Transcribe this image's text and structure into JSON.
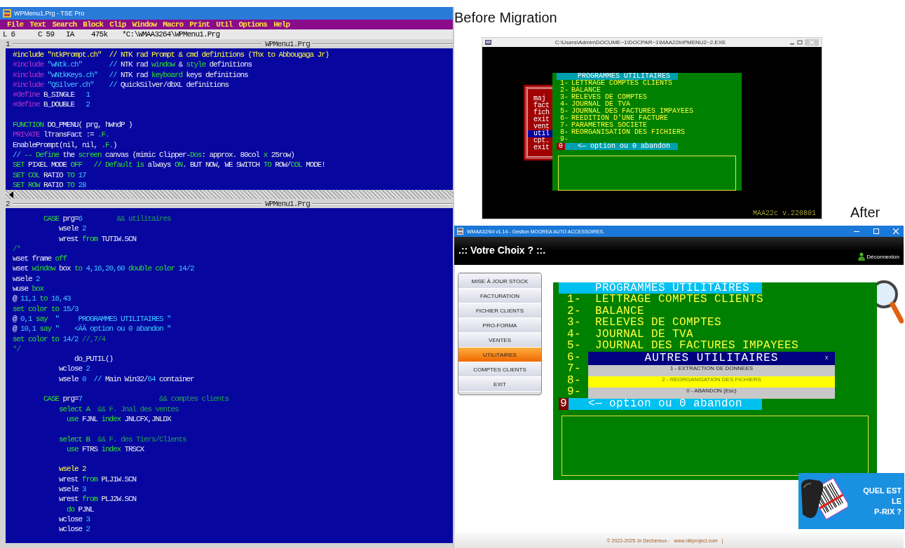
{
  "editor": {
    "title": "WPMenu1.Prg - TSE Pro",
    "menu": [
      "File",
      "Text",
      "Search",
      "Block",
      "Clip",
      "Window",
      "Macro",
      "Print",
      "Util",
      "Options",
      "Help"
    ],
    "status": [
      "L 6",
      "C 59",
      "IA",
      "475k",
      "*C:\\WMAA3264\\WPMenu1.Prg"
    ],
    "panes": [
      {
        "number": "1",
        "filename": "WPMenu1.Prg",
        "scrollbar": true,
        "blocks": [
          {
            "lines": [
              {
                "segments": [
                  {
                    "kind": "current",
                    "text": "#include \"ntkPrompt.ch\"  // NTK rad Prompt & cmd definitions (Thx to Abbougaga Jr)"
                  }
                ]
              },
              {
                "segments": [
                  {
                    "kind": "directive",
                    "text": "#include"
                  },
                  {
                    "kind": "string",
                    "text": " \"wNtk.ch\"       //"
                  },
                  {
                    "kind": "plain",
                    "text": " NTK rad "
                  },
                  {
                    "kind": "keyword",
                    "text": "window"
                  },
                  {
                    "kind": "plain",
                    "text": " & "
                  },
                  {
                    "kind": "keyword",
                    "text": "style"
                  },
                  {
                    "kind": "plain",
                    "text": " definitions"
                  }
                ]
              },
              {
                "segments": [
                  {
                    "kind": "directive",
                    "text": "#include"
                  },
                  {
                    "kind": "string",
                    "text": " \"wNtkKeys.ch\"   //"
                  },
                  {
                    "kind": "plain",
                    "text": " NTK rad "
                  },
                  {
                    "kind": "keyword",
                    "text": "keyboard"
                  },
                  {
                    "kind": "plain",
                    "text": " keys definitions"
                  }
                ]
              },
              {
                "segments": [
                  {
                    "kind": "directive",
                    "text": "#include"
                  },
                  {
                    "kind": "string",
                    "text": " \"QSilver.ch\"    //"
                  },
                  {
                    "kind": "plain",
                    "text": " QuickSilver/dbXL definitions"
                  }
                ]
              },
              {
                "segments": [
                  {
                    "kind": "directive",
                    "text": "#define"
                  },
                  {
                    "kind": "plain",
                    "text": " B_SINGLE   "
                  },
                  {
                    "kind": "number",
                    "text": "1"
                  }
                ]
              },
              {
                "segments": [
                  {
                    "kind": "directive",
                    "text": "#define"
                  },
                  {
                    "kind": "plain",
                    "text": " B_DOUBLE   "
                  },
                  {
                    "kind": "number",
                    "text": "2"
                  }
                ]
              }
            ]
          },
          {
            "lines": [
              {
                "segments": [
                  {
                    "kind": "keyword",
                    "text": "FUNCTION"
                  },
                  {
                    "kind": "plain",
                    "text": " DO_PMENU( prg, hWndP )"
                  }
                ]
              },
              {
                "segments": [
                  {
                    "kind": "directive",
                    "text": "PRIVATE"
                  },
                  {
                    "kind": "plain",
                    "text": " lTransFact := "
                  },
                  {
                    "kind": "keyword",
                    "text": ".F."
                  }
                ]
              },
              {
                "segments": [
                  {
                    "kind": "plain",
                    "text": "EnablePrompt(nil, nil, "
                  },
                  {
                    "kind": "keyword",
                    "text": ".F."
                  },
                  {
                    "kind": "plain",
                    "text": ")"
                  }
                ]
              },
              {
                "segments": [
                  {
                    "kind": "string",
                    "text": "//"
                  },
                  {
                    "kind": "keyword",
                    "text": " -- Define"
                  },
                  {
                    "kind": "plain",
                    "text": " the "
                  },
                  {
                    "kind": "keyword",
                    "text": "screen"
                  },
                  {
                    "kind": "plain",
                    "text": " canvas (mimic Clipper-"
                  },
                  {
                    "kind": "keyword",
                    "text": "Dos"
                  },
                  {
                    "kind": "plain",
                    "text": ": approx. 80col "
                  },
                  {
                    "kind": "keyword",
                    "text": "x"
                  },
                  {
                    "kind": "plain",
                    "text": " 25row)"
                  }
                ]
              },
              {
                "segments": [
                  {
                    "kind": "keyword",
                    "text": "SET"
                  },
                  {
                    "kind": "plain",
                    "text": " PIXEL MODE "
                  },
                  {
                    "kind": "keyword",
                    "text": "OFF   // Default is"
                  },
                  {
                    "kind": "plain",
                    "text": " always "
                  },
                  {
                    "kind": "keyword",
                    "text": "ON"
                  },
                  {
                    "kind": "plain",
                    "text": ". BUT NOW, WE SWITCH "
                  },
                  {
                    "kind": "keyword",
                    "text": "TO"
                  },
                  {
                    "kind": "plain",
                    "text": " ROW/"
                  },
                  {
                    "kind": "keyword",
                    "text": "COL"
                  },
                  {
                    "kind": "plain",
                    "text": " MODE!"
                  }
                ]
              },
              {
                "segments": [
                  {
                    "kind": "keyword",
                    "text": "SET COL"
                  },
                  {
                    "kind": "plain",
                    "text": " RATIO "
                  },
                  {
                    "kind": "keyword",
                    "text": "TO"
                  },
                  {
                    "kind": "number",
                    "text": " 17"
                  }
                ]
              },
              {
                "segments": [
                  {
                    "kind": "keyword",
                    "text": "SET ROW"
                  },
                  {
                    "kind": "plain",
                    "text": " RATIO "
                  },
                  {
                    "kind": "keyword",
                    "text": "TO"
                  },
                  {
                    "kind": "number",
                    "text": " 28"
                  }
                ]
              }
            ]
          }
        ]
      },
      {
        "number": "2",
        "filename": "WPMenu1.Prg",
        "blocks": [
          {
            "lines": [
              {
                "segments": [
                  {
                    "kind": "keyword",
                    "text": "        CASE"
                  },
                  {
                    "kind": "plain",
                    "text": " prg="
                  },
                  {
                    "kind": "number",
                    "text": "6"
                  },
                  {
                    "kind": "comment",
                    "text": "         && utilitaires"
                  }
                ]
              },
              {
                "segments": [
                  {
                    "kind": "plain",
                    "text": "            wsele "
                  },
                  {
                    "kind": "number",
                    "text": "2"
                  }
                ]
              },
              {
                "segments": [
                  {
                    "kind": "plain",
                    "text": "            wrest "
                  },
                  {
                    "kind": "keyword",
                    "text": "from"
                  },
                  {
                    "kind": "plain",
                    "text": " TUTIW.SCN"
                  }
                ]
              },
              {
                "segments": [
                  {
                    "kind": "comment",
                    "text": "/*"
                  }
                ]
              },
              {
                "segments": [
                  {
                    "kind": "plain",
                    "text": "wset frame "
                  },
                  {
                    "kind": "keyword",
                    "text": "off"
                  }
                ]
              },
              {
                "segments": [
                  {
                    "kind": "plain",
                    "text": "wset "
                  },
                  {
                    "kind": "keyword",
                    "text": "window"
                  },
                  {
                    "kind": "plain",
                    "text": " box "
                  },
                  {
                    "kind": "keyword",
                    "text": "to"
                  },
                  {
                    "kind": "number",
                    "text": " 4,16,20,60"
                  },
                  {
                    "kind": "keyword",
                    "text": " double color"
                  },
                  {
                    "kind": "number",
                    "text": " 14/2"
                  }
                ]
              },
              {
                "segments": [
                  {
                    "kind": "plain",
                    "text": "wsele "
                  },
                  {
                    "kind": "number",
                    "text": "2"
                  }
                ]
              },
              {
                "segments": [
                  {
                    "kind": "plain",
                    "text": "wuse "
                  },
                  {
                    "kind": "keyword",
                    "text": "box"
                  }
                ]
              },
              {
                "segments": [
                  {
                    "kind": "plain",
                    "text": "@ "
                  },
                  {
                    "kind": "number",
                    "text": "11,1"
                  },
                  {
                    "kind": "keyword",
                    "text": " to"
                  },
                  {
                    "kind": "number",
                    "text": " 16,43"
                  }
                ]
              },
              {
                "segments": [
                  {
                    "kind": "keyword",
                    "text": "set color to"
                  },
                  {
                    "kind": "number",
                    "text": " 15/3"
                  }
                ]
              },
              {
                "segments": [
                  {
                    "kind": "plain",
                    "text": "@ "
                  },
                  {
                    "kind": "number",
                    "text": "0,1"
                  },
                  {
                    "kind": "keyword",
                    "text": " say"
                  },
                  {
                    "kind": "string",
                    "text": "  \"     PROGRAMMES UTILITAIRES \""
                  }
                ]
              },
              {
                "segments": [
                  {
                    "kind": "plain",
                    "text": "@ "
                  },
                  {
                    "kind": "number",
                    "text": "10,1"
                  },
                  {
                    "kind": "keyword",
                    "text": " say"
                  },
                  {
                    "kind": "string",
                    "text": " \"    <ÄÄ option ou 0 abandon \""
                  }
                ]
              },
              {
                "segments": [
                  {
                    "kind": "keyword",
                    "text": "set color to"
                  },
                  {
                    "kind": "number",
                    "text": " 14/2"
                  },
                  {
                    "kind": "comment",
                    "text": " //,7/4"
                  }
                ]
              },
              {
                "segments": [
                  {
                    "kind": "comment",
                    "text": "*/"
                  }
                ]
              },
              {
                "segments": [
                  {
                    "kind": "plain",
                    "text": "                do_PUTIL()"
                  }
                ]
              },
              {
                "segments": [
                  {
                    "kind": "plain",
                    "text": "            wclose "
                  },
                  {
                    "kind": "number",
                    "text": "2"
                  }
                ]
              },
              {
                "segments": [
                  {
                    "kind": "plain",
                    "text": "            wsele "
                  },
                  {
                    "kind": "number",
                    "text": "0"
                  },
                  {
                    "kind": "string",
                    "text": "  //"
                  },
                  {
                    "kind": "plain",
                    "text": " Main Win32/"
                  },
                  {
                    "kind": "number",
                    "text": "64"
                  },
                  {
                    "kind": "plain",
                    "text": " container"
                  }
                ]
              }
            ]
          },
          {
            "lines": [
              {
                "segments": [
                  {
                    "kind": "keyword",
                    "text": "        CASE"
                  },
                  {
                    "kind": "plain",
                    "text": " prg="
                  },
                  {
                    "kind": "number",
                    "text": "7"
                  },
                  {
                    "kind": "comment",
                    "text": "                    && comptes clients"
                  }
                ]
              },
              {
                "segments": [
                  {
                    "kind": "keyword",
                    "text": "            select A"
                  },
                  {
                    "kind": "comment",
                    "text": "  && F. Jnal des ventes"
                  }
                ]
              },
              {
                "segments": [
                  {
                    "kind": "keyword",
                    "text": "              use"
                  },
                  {
                    "kind": "plain",
                    "text": " FJNL "
                  },
                  {
                    "kind": "keyword",
                    "text": "index"
                  },
                  {
                    "kind": "plain",
                    "text": " JNLCFX,JNLDX"
                  }
                ]
              }
            ]
          },
          {
            "lines": [
              {
                "segments": [
                  {
                    "kind": "keyword",
                    "text": "            select B"
                  },
                  {
                    "kind": "comment",
                    "text": "  && F. des Tiers/Clients"
                  }
                ]
              },
              {
                "segments": [
                  {
                    "kind": "keyword",
                    "text": "              use"
                  },
                  {
                    "kind": "plain",
                    "text": " FTRS "
                  },
                  {
                    "kind": "keyword",
                    "text": "index"
                  },
                  {
                    "kind": "plain",
                    "text": " TRSCX"
                  }
                ]
              }
            ]
          },
          {
            "lines": [
              {
                "segments": [
                  {
                    "kind": "current",
                    "text": "            wsele 2"
                  }
                ]
              },
              {
                "segments": [
                  {
                    "kind": "plain",
                    "text": "            wrest "
                  },
                  {
                    "kind": "keyword",
                    "text": "from"
                  },
                  {
                    "kind": "plain",
                    "text": " PLJ1W.SCN"
                  }
                ]
              },
              {
                "segments": [
                  {
                    "kind": "plain",
                    "text": "            wsele "
                  },
                  {
                    "kind": "number",
                    "text": "3"
                  }
                ]
              },
              {
                "segments": [
                  {
                    "kind": "plain",
                    "text": "            wrest "
                  },
                  {
                    "kind": "keyword",
                    "text": "from"
                  },
                  {
                    "kind": "plain",
                    "text": " PLJ2W.SCN"
                  }
                ]
              },
              {
                "segments": [
                  {
                    "kind": "keyword",
                    "text": "              do"
                  },
                  {
                    "kind": "plain",
                    "text": " PJNL"
                  }
                ]
              },
              {
                "segments": [
                  {
                    "kind": "plain",
                    "text": "            wclose "
                  },
                  {
                    "kind": "number",
                    "text": "3"
                  }
                ]
              },
              {
                "segments": [
                  {
                    "kind": "plain",
                    "text": "            wclose "
                  },
                  {
                    "kind": "number",
                    "text": "2"
                  }
                ]
              }
            ]
          }
        ]
      }
    ]
  },
  "before": {
    "label": "Before Migration",
    "window": {
      "title": "C:\\Users\\Admin\\DOCUME~1\\DOCPAR~1\\MAA22b\\PMENU2~2.EXE",
      "main_menu": [
        {
          "label": "maj",
          "selected": false
        },
        {
          "label": "fact",
          "selected": false
        },
        {
          "label": "fich",
          "selected": false
        },
        {
          "label": "exit",
          "selected": false
        },
        {
          "label": "vent",
          "selected": false
        },
        {
          "label": "util",
          "selected": true
        },
        {
          "label": "cpt.",
          "selected": false
        },
        {
          "label": "exit",
          "selected": false
        }
      ],
      "panel": {
        "title": "PROGRAMMES UTILITAIRES",
        "items": [
          {
            "number": "1-",
            "label": "LETTRAGE COMPTES CLIENTS"
          },
          {
            "number": "2-",
            "label": "BALANCE"
          },
          {
            "number": "3-",
            "label": "RELEVES DE COMPTES"
          },
          {
            "number": "4-",
            "label": "JOURNAL DE TVA"
          },
          {
            "number": "5-",
            "label": "JOURNAL DES FACTURES IMPAYEES"
          },
          {
            "number": "6-",
            "label": "REEDITION D'UNE FACTURE"
          },
          {
            "number": "7-",
            "label": "PARAMETRES SOCIETE"
          },
          {
            "number": "8-",
            "label": "REORGANISATION DES FICHIERS"
          },
          {
            "number": "9-"
          }
        ],
        "prompt": {
          "value": "0",
          "text": "<— option ou 0 abandon"
        }
      },
      "version": "MAA22c v.220801"
    }
  },
  "after": {
    "label": "After",
    "window": {
      "title": "WMAA32/64 v1.14 -  Gestion MOOREA AUTO ACCESSOIRES.",
      "header": ".:: Votre Choix ? ::.",
      "logout": "Déconnexion",
      "menu": [
        {
          "label": "MISE À JOUR STOCK",
          "selected": false
        },
        {
          "label": "FACTURATION",
          "selected": false
        },
        {
          "label": "FICHIER CLIENTS",
          "selected": false
        },
        {
          "label": "PRO-FORMA",
          "selected": false
        },
        {
          "label": "VENTES",
          "selected": false
        },
        {
          "label": "UTILITAIRES",
          "selected": true
        },
        {
          "label": "COMPTES CLIENTS",
          "selected": false
        },
        {
          "label": "EXIT",
          "selected": false
        }
      ],
      "panel": {
        "title": "PROGRAMMES UTILITAIRES",
        "items": [
          {
            "number": "1-",
            "label": "LETTRAGE COMPTES CLIENTS"
          },
          {
            "number": "2-",
            "label": "BALANCE"
          },
          {
            "number": "3-",
            "label": "RELEVES DE COMPTES"
          },
          {
            "number": "4-",
            "label": "JOURNAL DE TVA"
          },
          {
            "number": "5-",
            "label": "JOURNAL DES FACTURES IMPAYEES"
          },
          {
            "number": "6-"
          },
          {
            "number": "7-"
          },
          {
            "number": "8-"
          },
          {
            "number": "9-"
          }
        ],
        "prompt": {
          "value": "9",
          "text": "<— option ou 0 abandon"
        }
      },
      "dialog": {
        "title": "AUTRES UTILITAIRES",
        "close": "x",
        "options": [
          {
            "label": "1 - EXTRACTION DE DONNEES",
            "selected": false
          },
          {
            "label": "2 - REORGANISATION DES FICHIERS",
            "selected": true
          },
          {
            "label": "0 - ABANDON (Esc)",
            "selected": false
          }
        ]
      },
      "promo": {
        "lines": [
          "QUEL EST",
          "LE",
          "P-RIX ?"
        ]
      },
      "footer": [
        "© 2022-2025  Jn Dechereux -",
        "www.ntkproject.com",
        "|"
      ]
    }
  }
}
